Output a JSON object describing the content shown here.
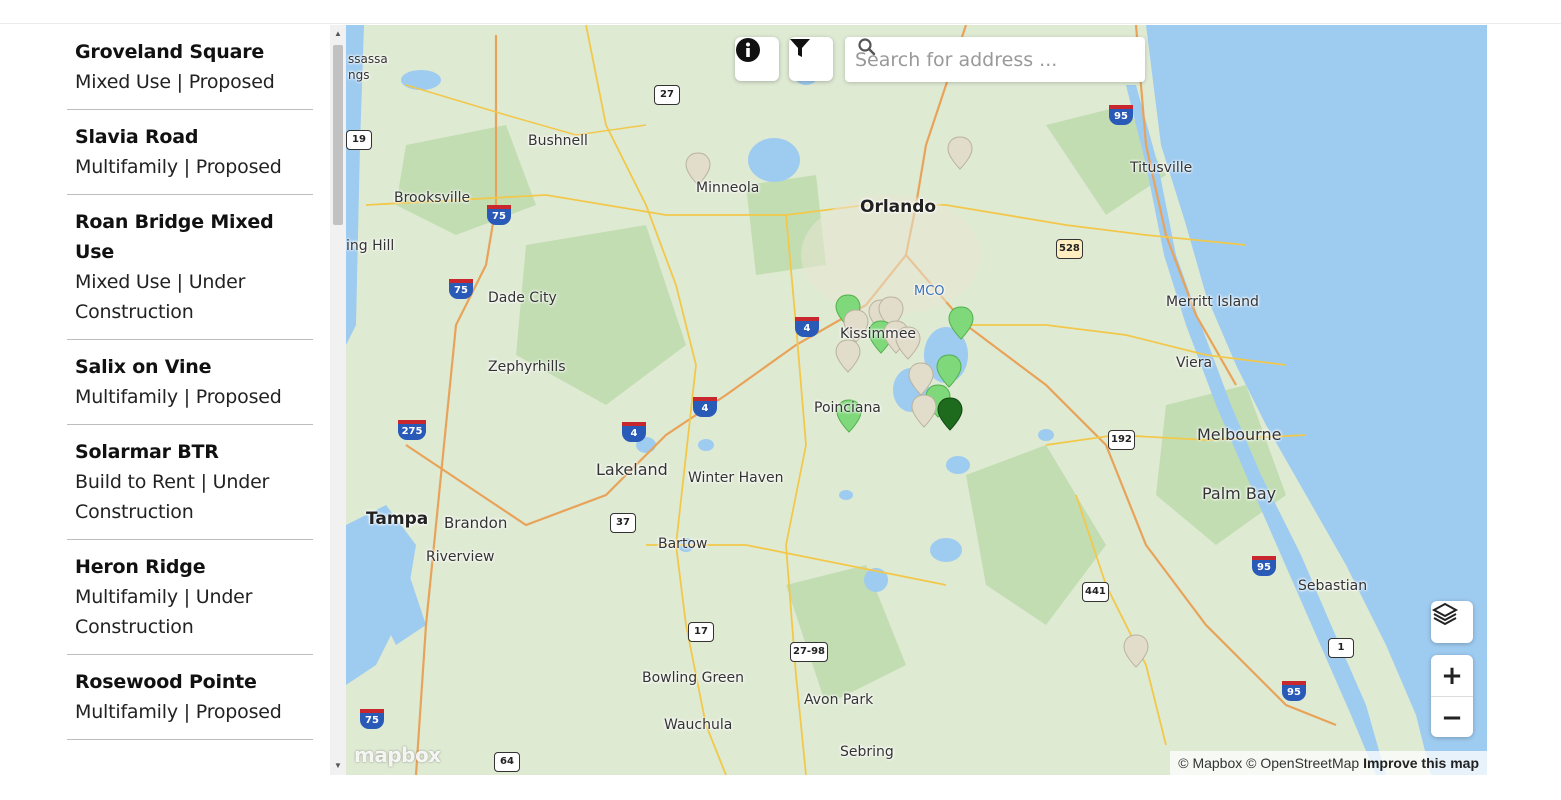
{
  "projects": [
    {
      "name": "Groveland Square",
      "meta": "Mixed Use | Proposed"
    },
    {
      "name": "Slavia Road",
      "meta": "Multifamily | Proposed"
    },
    {
      "name": "Roan Bridge Mixed Use",
      "meta": "Mixed Use | Under Construction"
    },
    {
      "name": "Salix on Vine",
      "meta": "Multifamily | Proposed"
    },
    {
      "name": "Solarmar BTR",
      "meta": "Build to Rent | Under Construction"
    },
    {
      "name": "Heron Ridge",
      "meta": "Multifamily | Under Construction"
    },
    {
      "name": "Rosewood Pointe",
      "meta": "Multifamily | Proposed"
    }
  ],
  "search": {
    "placeholder": "Search for address ..."
  },
  "map": {
    "cities": [
      "Orlando",
      "Tampa",
      "Lakeland",
      "Titusville",
      "Minneola",
      "Bushnell",
      "Brooksville",
      "Dade City",
      "Zephyrhills",
      "Winter Haven",
      "Bartow",
      "Brandon",
      "Riverview",
      "Merritt Island",
      "Viera",
      "Melbourne",
      "Palm Bay",
      "Sebastian",
      "Bowling Green",
      "Avon Park",
      "Wauchula",
      "Sebring",
      "MCO",
      "Kissimmee",
      "Poinciana",
      "ing Hill",
      "ssassa",
      "ngs"
    ],
    "shields": [
      "27",
      "75",
      "95",
      "528",
      "4",
      "75",
      "275",
      "4",
      "4",
      "192",
      "37",
      "17",
      "27-98",
      "441",
      "95",
      "1",
      "95",
      "75",
      "64",
      "19"
    ],
    "colors": {
      "water": "#9ecbf0",
      "land": "#dfead3",
      "park": "#c3ddb3",
      "marker_green": "#7fd87a",
      "marker_dark": "#1e6b1e",
      "marker_gray": "#e2dccb"
    },
    "attribution": {
      "text": "© Mapbox © OpenStreetMap",
      "improve": "Improve this map"
    },
    "logo": "mapbox"
  },
  "controls": {
    "zoom_in": "+",
    "zoom_out": "−"
  }
}
